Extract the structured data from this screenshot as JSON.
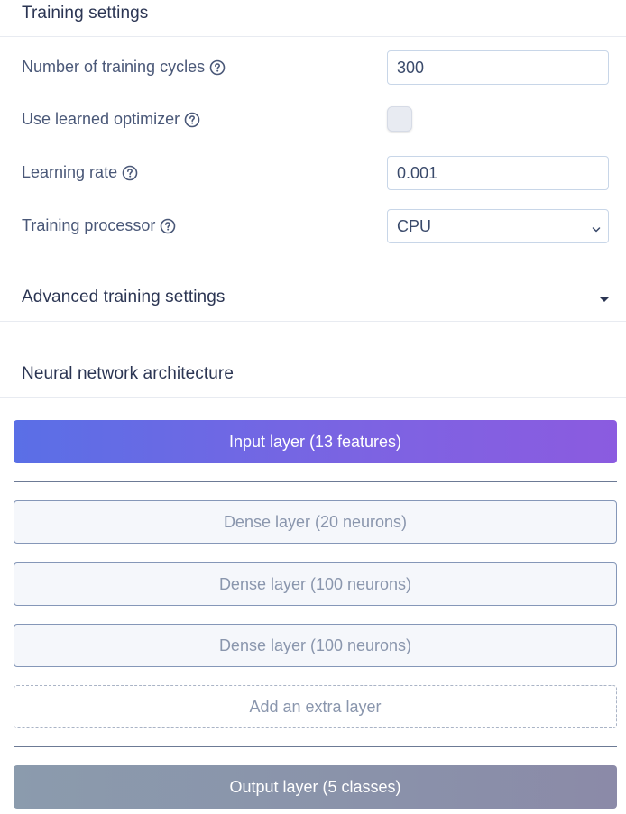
{
  "training_settings": {
    "title": "Training settings",
    "cycles": {
      "label": "Number of training cycles",
      "value": "300"
    },
    "learned_optimizer": {
      "label": "Use learned optimizer",
      "checked": false
    },
    "learning_rate": {
      "label": "Learning rate",
      "value": "0.001"
    },
    "processor": {
      "label": "Training processor",
      "value": "CPU"
    }
  },
  "advanced": {
    "title": "Advanced training settings"
  },
  "architecture": {
    "title": "Neural network architecture",
    "input_layer": "Input layer (13 features)",
    "layers": [
      {
        "label": "Dense layer (20 neurons)"
      },
      {
        "label": "Dense layer (100 neurons)"
      },
      {
        "label": "Dense layer (100 neurons)"
      }
    ],
    "add_layer": "Add an extra layer",
    "output_layer": "Output layer (5 classes)"
  },
  "colors": {
    "accent_start": "#5a6fe6",
    "accent_end": "#8b5be0",
    "output": "#8a94ab",
    "text": "#4a5878"
  },
  "icons": {
    "help": "question-circle-icon",
    "caret": "caret-down-icon",
    "chevron": "chevron-down-icon"
  }
}
